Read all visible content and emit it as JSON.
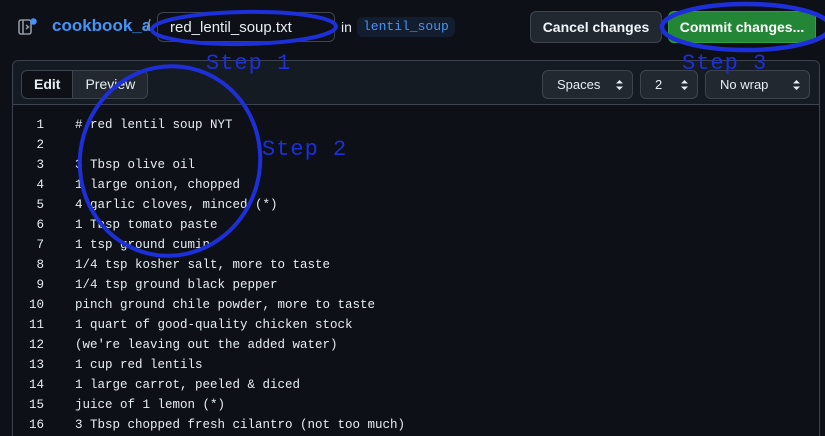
{
  "header": {
    "repo_name": "cookbook_a",
    "path_separator": "/",
    "filename_value": "red_lentil_soup.txt",
    "in_label": "in",
    "branch": "lentil_soup",
    "cancel_label": "Cancel changes",
    "commit_label": "Commit changes..."
  },
  "editor": {
    "tabs": [
      {
        "label": "Edit",
        "active": true
      },
      {
        "label": "Preview",
        "active": false
      }
    ],
    "indent_mode": "Spaces",
    "indent_size": "2",
    "wrap_mode": "No wrap",
    "lines": [
      {
        "number": "1",
        "text": "# red lentil soup NYT"
      },
      {
        "number": "2",
        "text": ""
      },
      {
        "number": "3",
        "text": "3 Tbsp olive oil"
      },
      {
        "number": "4",
        "text": "1 large onion, chopped"
      },
      {
        "number": "5",
        "text": "4 garlic cloves, minced (*)"
      },
      {
        "number": "6",
        "text": "1 Tbsp tomato paste"
      },
      {
        "number": "7",
        "text": "1 tsp ground cumin"
      },
      {
        "number": "8",
        "text": "1/4 tsp kosher salt, more to taste"
      },
      {
        "number": "9",
        "text": "1/4 tsp ground black pepper"
      },
      {
        "number": "10",
        "text": "pinch ground chile powder, more to taste"
      },
      {
        "number": "11",
        "text": "1 quart of good-quality chicken stock"
      },
      {
        "number": "12",
        "text": "(we're leaving out the added water)"
      },
      {
        "number": "13",
        "text": "1 cup red lentils"
      },
      {
        "number": "14",
        "text": "1 large carrot, peeled & diced"
      },
      {
        "number": "15",
        "text": "juice of 1 lemon (*)"
      },
      {
        "number": "16",
        "text": "3 Tbsp chopped fresh cilantro (not too much)"
      }
    ]
  },
  "annotations": {
    "step1": "Step 1",
    "step2": "Step 2",
    "step3": "Step 3",
    "color": "#1d2fd8"
  },
  "colors": {
    "background": "#0d1117",
    "link": "#4493f8",
    "commit": "#238636"
  }
}
